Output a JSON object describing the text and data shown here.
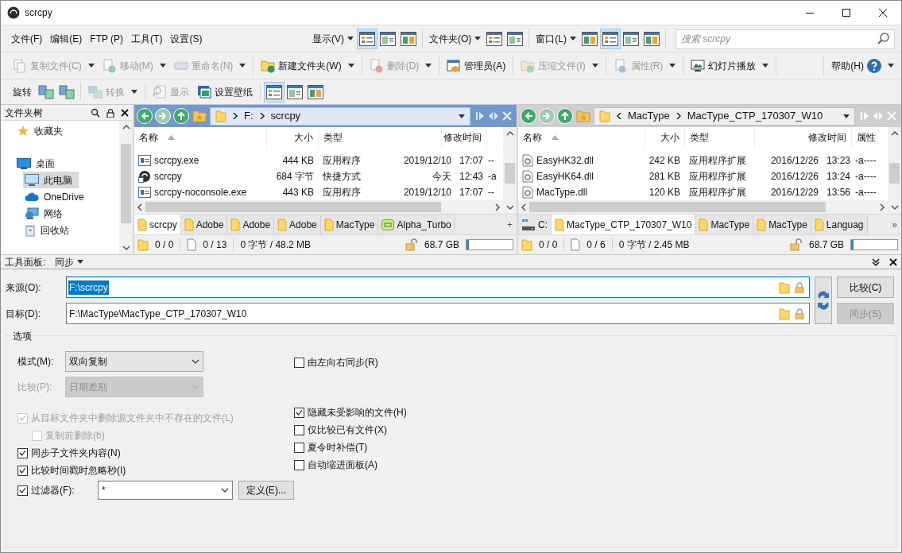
{
  "window": {
    "title": "scrcpy"
  },
  "toolbar1": {
    "menus": [
      "文件(F)",
      "编辑(E)",
      "FTP (P)",
      "工具(T)",
      "设置(S)"
    ],
    "groups": [
      {
        "label": "显示(V)",
        "buttons": [
          {
            "selected": true
          },
          {
            "selected": false
          },
          {
            "selected": false
          }
        ]
      },
      {
        "label": "文件夹(O)",
        "buttons": [
          {
            "selected": false
          },
          {
            "selected": false
          }
        ]
      },
      {
        "label": "窗口(L)",
        "buttons": [
          {
            "selected": false
          },
          {
            "selected": true
          },
          {
            "selected": false
          },
          {
            "selected": false
          }
        ]
      }
    ],
    "search": {
      "placeholder": "搜索 scrcpy"
    }
  },
  "toolbar2": {
    "groups": [
      [
        {
          "label": "复制文件(C)",
          "disabled": true,
          "dropdown": true
        },
        {
          "label": "移动(M)",
          "disabled": true,
          "dropdown": true
        },
        {
          "label": "重命名(N)",
          "disabled": true,
          "dropdown": true
        }
      ],
      [
        {
          "label": "新建文件夹(W)",
          "disabled": false,
          "dropdown": true
        }
      ],
      [
        {
          "label": "删除(D)",
          "disabled": true,
          "dropdown": true
        }
      ],
      [
        {
          "label": "管理员(A)",
          "disabled": false,
          "dropdown": false
        }
      ],
      [
        {
          "label": "压缩文件(I)",
          "disabled": true,
          "dropdown": true
        }
      ],
      [
        {
          "label": "属性(R)",
          "disabled": true,
          "dropdown": true
        }
      ],
      [
        {
          "label": "幻灯片播放",
          "disabled": false,
          "dropdown": true
        }
      ]
    ],
    "help": {
      "label": "帮助(H)",
      "dropdown": true
    }
  },
  "toolbar3": {
    "groups": [
      [
        {
          "kind": "label",
          "label": "旋转"
        },
        {
          "kind": "icon"
        },
        {
          "kind": "icon"
        }
      ],
      [
        {
          "kind": "button",
          "label": "转换",
          "disabled": true,
          "dropdown": true
        }
      ],
      [
        {
          "kind": "button",
          "label": "显示",
          "disabled": true,
          "dropdown": false
        },
        {
          "kind": "button",
          "label": "设置壁纸",
          "disabled": false,
          "dropdown": false
        }
      ],
      [
        {
          "kind": "toggle",
          "selected": true
        },
        {
          "kind": "toggle",
          "selected": false
        },
        {
          "kind": "toggle",
          "selected": false
        }
      ]
    ]
  },
  "folder_tree": {
    "title": "文件夹树",
    "items": [
      {
        "label": "收藏夹",
        "selected": false
      },
      {
        "label": "桌面",
        "selected": false,
        "children": [
          {
            "label": "此电脑",
            "selected": true
          },
          {
            "label": "OneDrive",
            "selected": false
          },
          {
            "label": "网络",
            "selected": false
          },
          {
            "label": "回收站",
            "selected": false
          }
        ]
      }
    ]
  },
  "panes": [
    {
      "active": true,
      "path": [
        "F:",
        "scrcpy"
      ],
      "path_truncated": false,
      "columns": [
        "名称",
        "大小",
        "类型",
        "修改时间"
      ],
      "rows": [
        {
          "kind": "exe",
          "name": "scrcpy.exe",
          "size": "444 KB",
          "type": "应用程序",
          "date": "2019/12/10",
          "time": "17:07",
          "attributes": "--"
        },
        {
          "kind": "shortcut",
          "name": "scrcpy",
          "size": "684 字节",
          "type": "快捷方式",
          "date": "今天",
          "time": "12:43",
          "attributes": "-a"
        },
        {
          "kind": "exe",
          "name": "scrcpy-noconsole.exe",
          "size": "443 KB",
          "type": "应用程序",
          "date": "2019/12/10",
          "time": "17:07",
          "attributes": "--"
        }
      ],
      "tabs": [
        {
          "kind": "folder",
          "label": "scrcpy",
          "selected": true
        },
        {
          "kind": "folder",
          "label": "Adobe",
          "selected": false
        },
        {
          "kind": "folder",
          "label": "Adobe",
          "selected": false
        },
        {
          "kind": "folder",
          "label": "Adobe",
          "selected": false
        },
        {
          "kind": "folder",
          "label": "MacType",
          "selected": false
        },
        {
          "kind": "archive",
          "label": "Alpha_Turbo",
          "selected": false
        }
      ],
      "tabs_end": "+",
      "status": {
        "folders": "0 / 0",
        "files": "0 / 13",
        "size": "0 字节 / 48.2 MB",
        "free": "68.7 GB",
        "level": 0.06
      }
    },
    {
      "active": false,
      "path": [
        "MacType",
        "MacType_CTP_170307_W10"
      ],
      "path_truncated": true,
      "columns": [
        "名称",
        "大小",
        "类型",
        "修改时间",
        "属性"
      ],
      "rows": [
        {
          "kind": "dll",
          "name": "EasyHK32.dll",
          "size": "242 KB",
          "type": "应用程序扩展",
          "date": "2016/12/26",
          "time": "13:23",
          "attributes": "-a----"
        },
        {
          "kind": "dll",
          "name": "EasyHK64.dll",
          "size": "281 KB",
          "type": "应用程序扩展",
          "date": "2016/12/26",
          "time": "13:24",
          "attributes": "-a----"
        },
        {
          "kind": "dll",
          "name": "MacType.dll",
          "size": "120 KB",
          "type": "应用程序扩展",
          "date": "2016/12/29",
          "time": "13:56",
          "attributes": "-a----"
        }
      ],
      "tabs": [
        {
          "kind": "drive",
          "label": "C:",
          "selected": false
        },
        {
          "kind": "folder",
          "label": "MacType_CTP_170307_W10",
          "selected": true
        },
        {
          "kind": "folder",
          "label": "MacType",
          "selected": false
        },
        {
          "kind": "folder",
          "label": "MacType",
          "selected": false
        },
        {
          "kind": "folder",
          "label": "Languag",
          "selected": false
        }
      ],
      "tabs_end": "»",
      "status": {
        "folders": "0 / 0",
        "files": "0 / 6",
        "size": "0 字节 / 2.45 MB",
        "free": "68.7 GB",
        "level": 0.06
      }
    }
  ],
  "tool_panel": {
    "title": "工具面板:",
    "mode": "同步",
    "source": {
      "label": "来源(O):",
      "value": "F:\\scrcpy",
      "selected": true
    },
    "target": {
      "label": "目标(D):",
      "value": "F:\\MacType\\MacType_CTP_170307_W10",
      "selected": false
    },
    "buttons": [
      {
        "label": "比较(C)",
        "disabled": false
      },
      {
        "label": "同步(S)",
        "disabled": true
      }
    ],
    "options": {
      "title": "选项",
      "mode": {
        "label": "模式(M):",
        "value": "双向复制",
        "disabled": false
      },
      "compare": {
        "label": "比较(P):",
        "value": "日期差别",
        "disabled": true
      },
      "left_checks": [
        {
          "label": "从目标文件夹中删除源文件夹中不存在的文件(L)",
          "checked": true,
          "disabled": true,
          "children": [
            {
              "label": "复制前删除(b)",
              "checked": false,
              "disabled": true
            }
          ]
        },
        {
          "label": "同步子文件夹内容(N)",
          "checked": true,
          "disabled": false
        },
        {
          "label": "比较时间戳时忽略秒(I)",
          "checked": true,
          "disabled": false
        }
      ],
      "filter": {
        "label": "过滤器(F):",
        "checked": true,
        "value": "*",
        "button": "定义(E)..."
      },
      "top_right_check": {
        "label": "由左向右同步(R)",
        "checked": false,
        "disabled": false
      },
      "right_checks": [
        {
          "label": "隐藏未受影响的文件(H)",
          "checked": true,
          "disabled": false
        },
        {
          "label": "仅比较已有文件(X)",
          "checked": false,
          "disabled": false
        },
        {
          "label": "夏令时补偿(T)",
          "checked": false,
          "disabled": false
        },
        {
          "label": "自动缩进面板(A)",
          "checked": false,
          "disabled": false
        }
      ]
    }
  }
}
